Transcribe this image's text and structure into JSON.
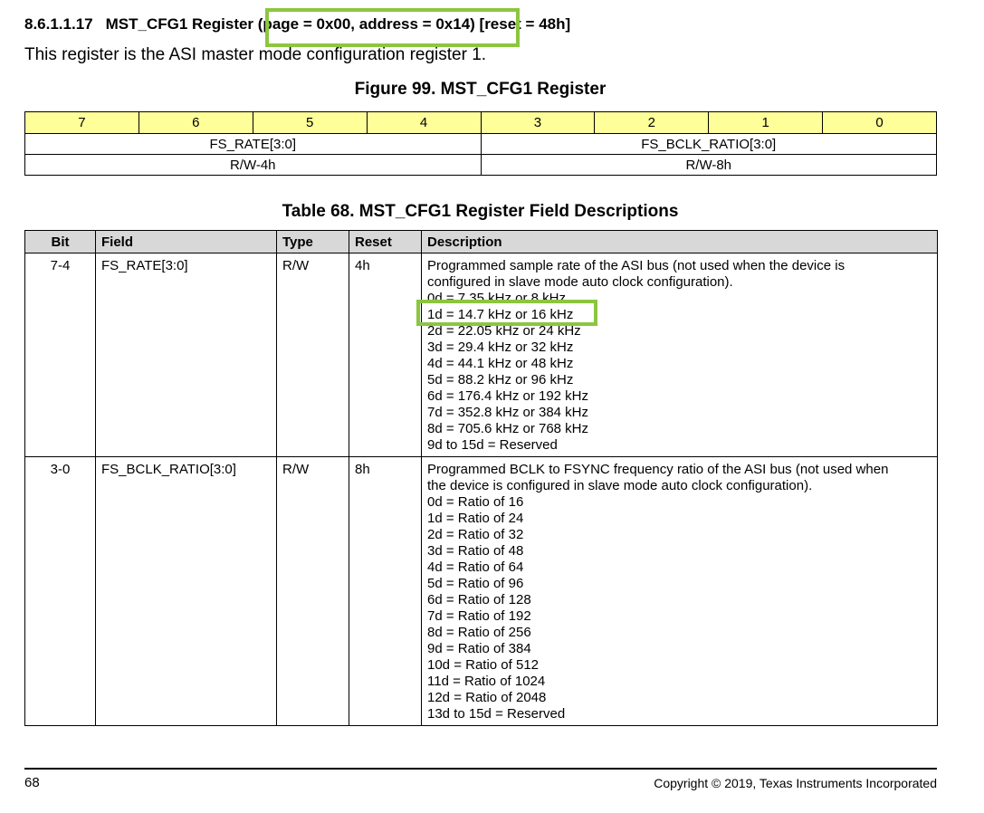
{
  "section": {
    "number": "8.6.1.1.17",
    "title": "MST_CFG1 Register (page = 0x00, address = 0x14) [reset = 48h]",
    "intro": "This register is the ASI master mode configuration register 1."
  },
  "figure": {
    "title": "Figure 99.  MST_CFG1 Register",
    "bits": [
      "7",
      "6",
      "5",
      "4",
      "3",
      "2",
      "1",
      "0"
    ],
    "fields": [
      {
        "name": "FS_RATE[3:0]",
        "access": "R/W-4h"
      },
      {
        "name": "FS_BCLK_RATIO[3:0]",
        "access": "R/W-8h"
      }
    ]
  },
  "table": {
    "title": "Table 68. MST_CFG1 Register Field Descriptions",
    "headers": [
      "Bit",
      "Field",
      "Type",
      "Reset",
      "Description"
    ],
    "rows": [
      {
        "bit": "7-4",
        "field": "FS_RATE[3:0]",
        "type": "R/W",
        "reset": "4h",
        "description": [
          "Programmed sample rate of the ASI bus (not used when the device is",
          "configured in slave mode auto clock configuration).",
          "0d = 7.35 kHz or 8 kHz",
          "1d = 14.7 kHz or 16 kHz",
          "2d = 22.05 kHz or 24 kHz",
          "3d = 29.4 kHz or 32 kHz",
          "4d = 44.1 kHz or 48 kHz",
          "5d = 88.2 kHz or 96 kHz",
          "6d = 176.4 kHz or 192 kHz",
          "7d = 352.8 kHz or 384 kHz",
          "8d = 705.6 kHz or 768 kHz",
          "9d to 15d = Reserved"
        ]
      },
      {
        "bit": "3-0",
        "field": "FS_BCLK_RATIO[3:0]",
        "type": "R/W",
        "reset": "8h",
        "description": [
          "Programmed BCLK to FSYNC frequency ratio of the ASI bus (not used when",
          "the device is configured in slave mode auto clock configuration).",
          "0d = Ratio of 16",
          "1d = Ratio of 24",
          "2d = Ratio of 32",
          "3d = Ratio of 48",
          "4d = Ratio of 64",
          "5d = Ratio of 96",
          "6d = Ratio of 128",
          "7d = Ratio of 192",
          "8d = Ratio of 256",
          "9d = Ratio of 384",
          "10d = Ratio of 512",
          "11d = Ratio of 1024",
          "12d = Ratio of 2048",
          "13d to 15d = Reserved"
        ]
      }
    ]
  },
  "footer": {
    "page_number": "68",
    "copyright": "Copyright © 2019, Texas Instruments Incorporated"
  },
  "colors": {
    "highlight": "#8cc63f",
    "bit_header_bg": "#ffff99",
    "table_header_bg": "#d8d8d8"
  }
}
